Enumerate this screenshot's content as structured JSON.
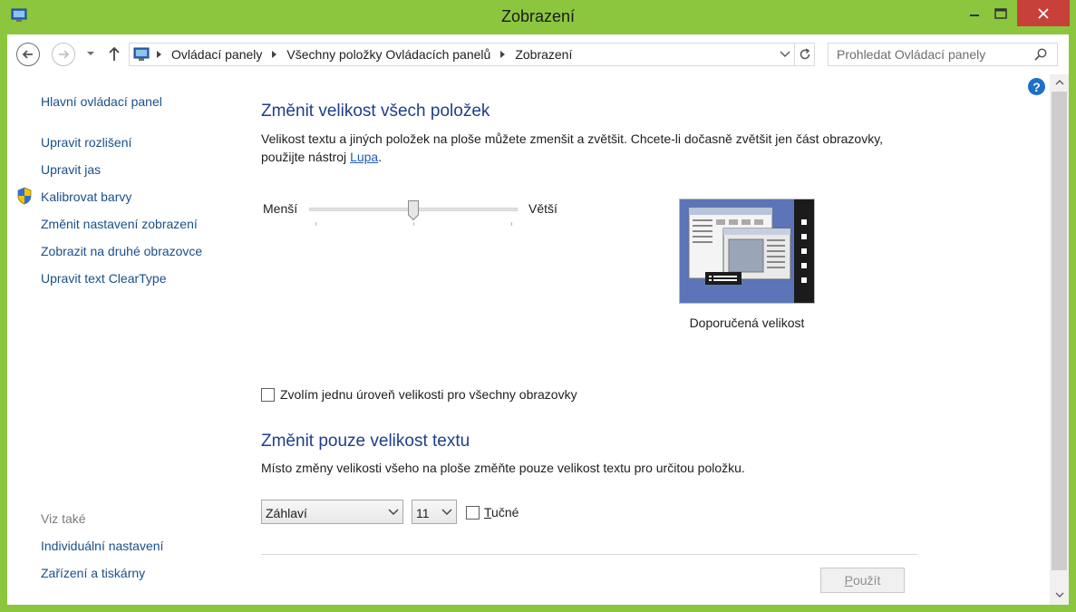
{
  "window": {
    "title": "Zobrazení",
    "accent": "#8cc63f",
    "close_color": "#c7413a"
  },
  "nav": {
    "breadcrumbs": [
      "Ovládací panely",
      "Všechny položky Ovládacích panelů",
      "Zobrazení"
    ],
    "search_placeholder": "Prohledat Ovládací panely"
  },
  "sidebar": {
    "home": "Hlavní ovládací panel",
    "items": [
      {
        "label": "Upravit rozlišení"
      },
      {
        "label": "Upravit jas"
      },
      {
        "label": "Kalibrovat barvy",
        "icon": "uac-shield-icon"
      },
      {
        "label": "Změnit nastavení zobrazení"
      },
      {
        "label": "Zobrazit na druhé obrazovce"
      },
      {
        "label": "Upravit text ClearType"
      }
    ],
    "see_also_heading": "Viz také",
    "see_also": [
      {
        "label": "Individuální nastavení"
      },
      {
        "label": "Zařízení a tiskárny"
      }
    ]
  },
  "main": {
    "section1": {
      "title": "Změnit velikost všech položek",
      "desc_before": "Velikost textu a jiných položek na ploše můžete zmenšit a zvětšit. Chcete-li dočasně zvětšit jen část obrazovky, použijte nástroj ",
      "desc_link": "Lupa",
      "desc_after": ".",
      "slider_min_label": "Menší",
      "slider_max_label": "Větší",
      "slider_level": 0.5,
      "preview_caption": "Doporučená velikost",
      "checkbox_label": "Zvolím jednu úroveň velikosti pro všechny obrazovky",
      "checkbox_checked": false
    },
    "section2": {
      "title": "Změnit pouze velikost textu",
      "desc": "Místo změny velikosti všeho na ploše změňte pouze velikost textu pro určitou položku.",
      "item_value": "Záhlaví",
      "size_value": "11",
      "bold_label": "Tučné",
      "bold_checked": false
    },
    "apply_label": "Použít",
    "help_icon": "?"
  }
}
